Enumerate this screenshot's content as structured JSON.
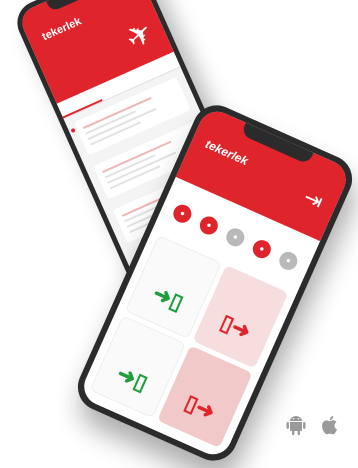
{
  "colors": {
    "brand_red": "#e0242b",
    "accent_green": "#1e9e3e",
    "neutral_grey": "#b9b9b9"
  },
  "back_phone": {
    "logo": "tekerlek",
    "icon": "airplane-icon"
  },
  "front_phone": {
    "logo": "tekerlek",
    "icon": "door-exit-icon",
    "tiles_icons": [
      "enter-arrow-icon",
      "exit-arrow-icon",
      "enter-arrow-icon",
      "exit-arrow-icon"
    ]
  },
  "os_badges": [
    "android-icon",
    "apple-icon"
  ]
}
